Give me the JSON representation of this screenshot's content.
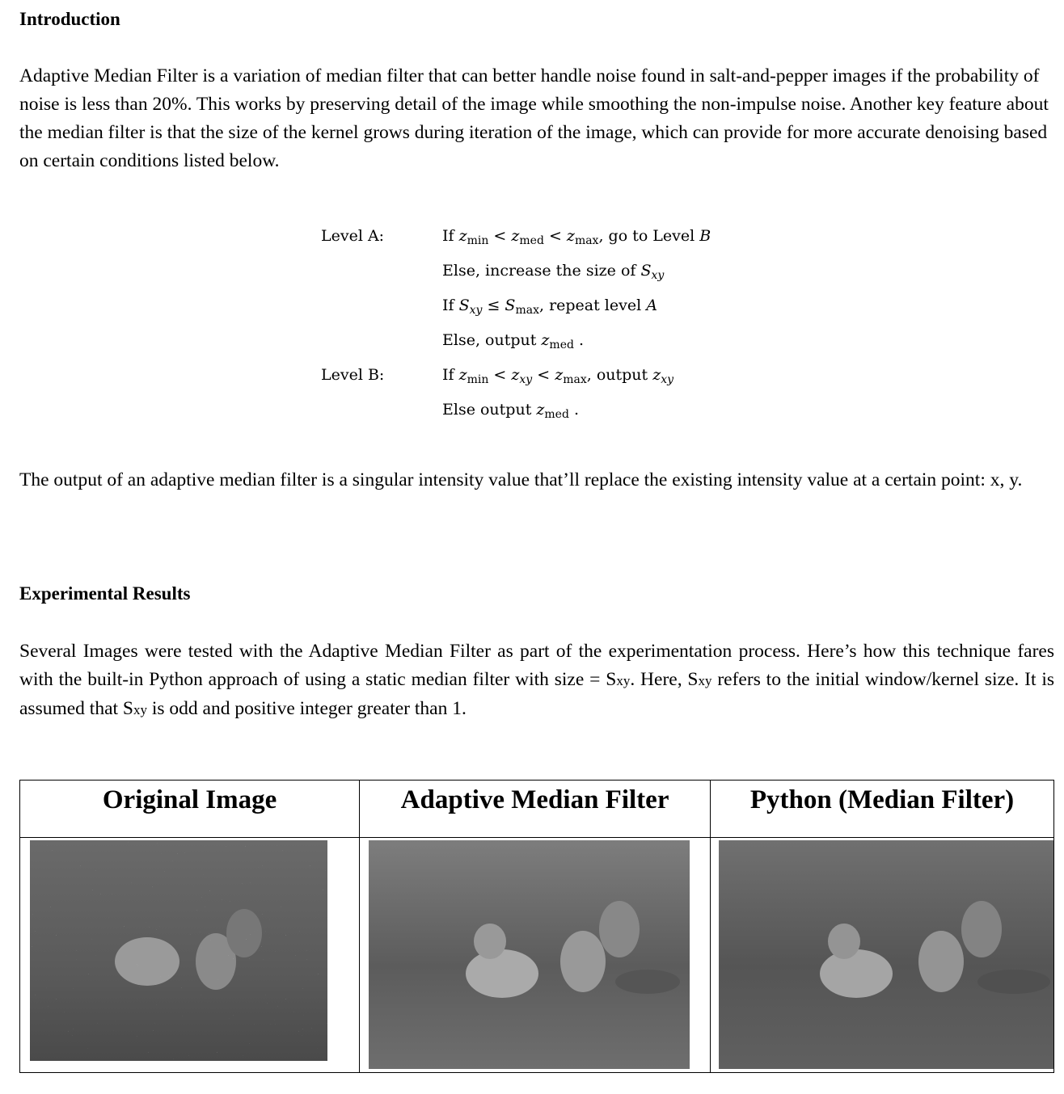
{
  "intro": {
    "heading": "Introduction",
    "paragraph": "Adaptive Median Filter is a variation of median filter that can better handle noise found in salt-and-pepper images if the probability of noise is less than 20%. This works by preserving detail of the image while smoothing the non-impulse noise. Another key feature about the median filter is that the size of the kernel grows during iteration of the image, which can provide for more accurate denoising based on certain conditions listed below."
  },
  "algorithm": {
    "level_a_label": "Level A:",
    "level_b_label": "Level B:",
    "lines": [
      [
        [
          "If "
        ],
        [
          "z",
          "i"
        ],
        [
          "min",
          "sub"
        ],
        [
          " < "
        ],
        [
          "z",
          "i"
        ],
        [
          "med",
          "sub"
        ],
        [
          " < "
        ],
        [
          "z",
          "i"
        ],
        [
          "max",
          "sub"
        ],
        [
          ", go to Level "
        ],
        [
          "B",
          "i"
        ]
      ],
      [
        [
          "Else, increase the size of "
        ],
        [
          "S",
          "i"
        ],
        [
          "xy",
          "subi"
        ]
      ],
      [
        [
          "If "
        ],
        [
          "S",
          "i"
        ],
        [
          "xy",
          "subi"
        ],
        [
          " ≤ "
        ],
        [
          "S",
          "i"
        ],
        [
          "max",
          "sub"
        ],
        [
          ", repeat level "
        ],
        [
          "A",
          "i"
        ]
      ],
      [
        [
          "Else, output "
        ],
        [
          "z",
          "i"
        ],
        [
          "med",
          "sub"
        ],
        [
          " ."
        ]
      ],
      [
        [
          "If "
        ],
        [
          "z",
          "i"
        ],
        [
          "min",
          "sub"
        ],
        [
          " < "
        ],
        [
          "z",
          "i"
        ],
        [
          "xy",
          "subi"
        ],
        [
          " < "
        ],
        [
          "z",
          "i"
        ],
        [
          "max",
          "sub"
        ],
        [
          ", output "
        ],
        [
          "z",
          "i"
        ],
        [
          "xy",
          "subi"
        ]
      ],
      [
        [
          "Else output "
        ],
        [
          "z",
          "i"
        ],
        [
          "med",
          "sub"
        ],
        [
          " ."
        ]
      ]
    ]
  },
  "output_paragraph": "The output of an adaptive median filter is a singular intensity value that’ll replace the existing intensity value at a certain point: x, y.",
  "results": {
    "heading": "Experimental Results",
    "p1": "Several Images were tested with the Adaptive Median Filter as part of the experimentation process. Here’s how this technique fares with the built-in Python approach of using a static median filter with size = S",
    "sub1": "xy",
    "p2": ". Here, S",
    "sub2": "xy",
    "p3": " refers to the initial window/kernel size. It is assumed that S",
    "sub3": "xy",
    "p4": " is odd and positive integer greater than 1."
  },
  "table": {
    "headers": [
      "Original Image",
      "Adaptive Median Filter",
      "Python (Median Filter)"
    ]
  }
}
